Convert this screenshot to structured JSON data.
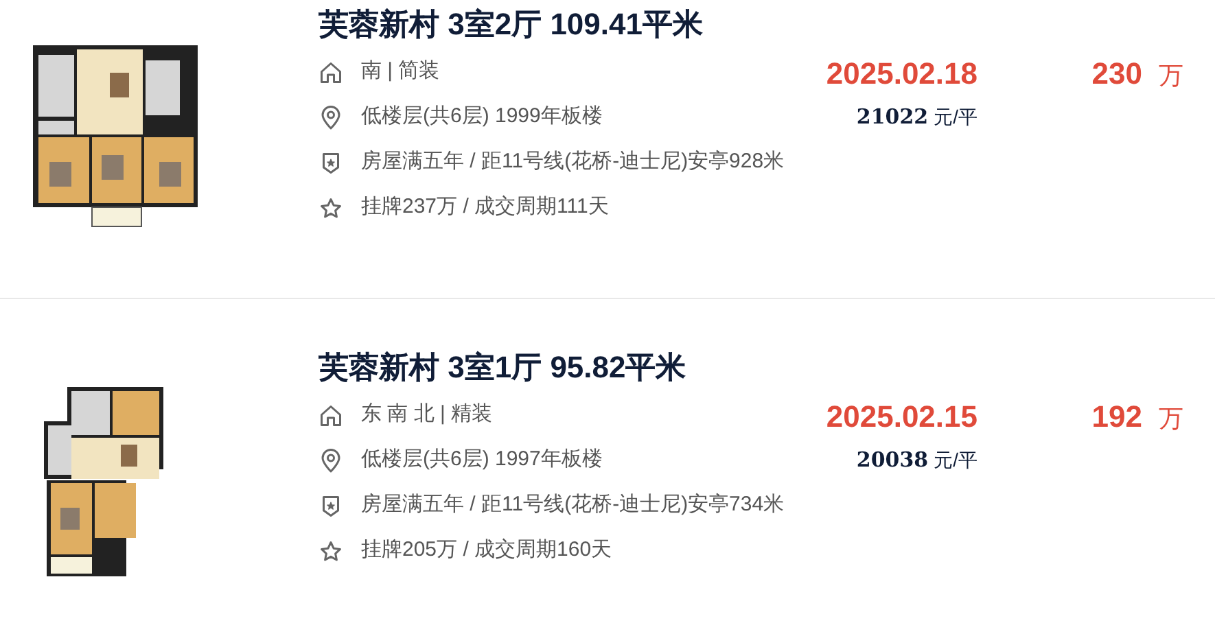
{
  "listings": [
    {
      "title": "芙蓉新村 3室2厅 109.41平米",
      "details": [
        {
          "kind": "house",
          "text": "南 | 简装"
        },
        {
          "kind": "location",
          "text": "低楼层(共6层) 1999年板楼"
        },
        {
          "kind": "badge",
          "text": "房屋满五年 / 距11号线(花桥-迪士尼)安亭928米"
        },
        {
          "kind": "star",
          "text": "挂牌237万 / 成交周期111天"
        }
      ],
      "deal_date": "2025.02.18",
      "unit_price": "21022",
      "unit_price_unit": "元/平",
      "total_price": "230",
      "total_price_unit": "万"
    },
    {
      "title": "芙蓉新村 3室1厅 95.82平米",
      "details": [
        {
          "kind": "house",
          "text": "东 南 北 | 精装"
        },
        {
          "kind": "location",
          "text": "低楼层(共6层) 1997年板楼"
        },
        {
          "kind": "badge",
          "text": "房屋满五年 / 距11号线(花桥-迪士尼)安亭734米"
        },
        {
          "kind": "star",
          "text": "挂牌205万 / 成交周期160天"
        }
      ],
      "deal_date": "2025.02.15",
      "unit_price": "20038",
      "unit_price_unit": "元/平",
      "total_price": "192",
      "total_price_unit": "万"
    }
  ]
}
